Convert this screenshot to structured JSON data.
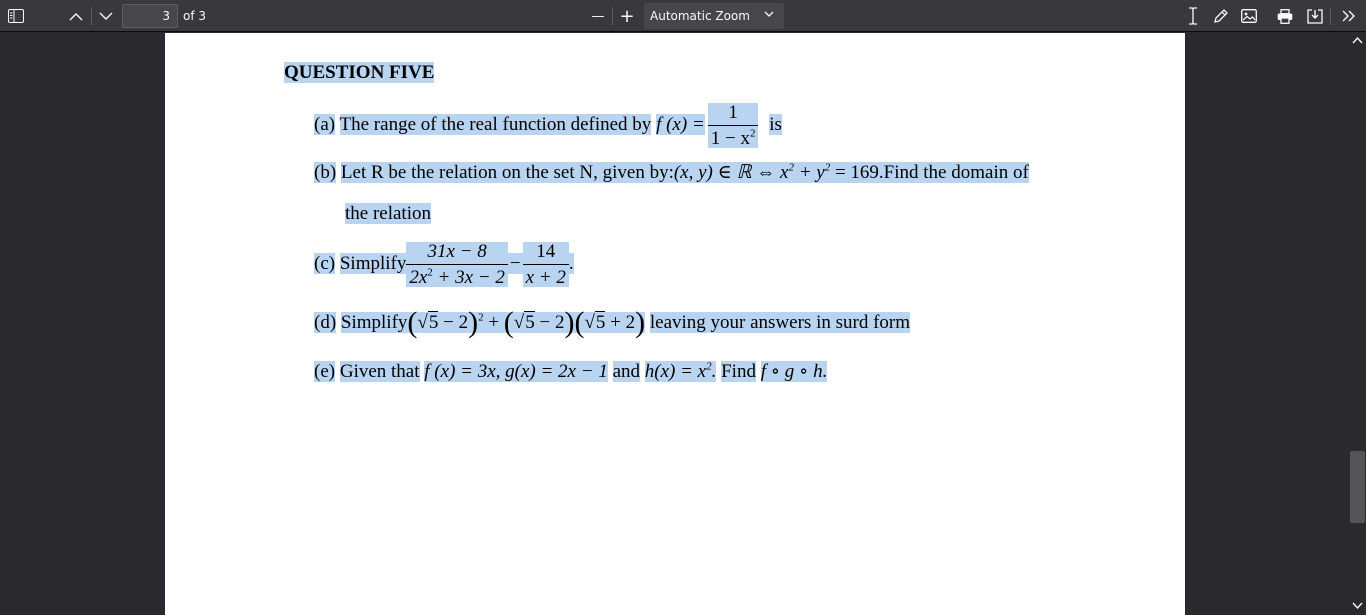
{
  "toolbar": {
    "page_number": "3",
    "page_count": "of 3",
    "zoom_label": "Automatic Zoom",
    "zoom_out_symbol": "—",
    "zoom_in_symbol": "+"
  },
  "icons": {
    "sidebar": "sidebar-toggle-icon",
    "prev": "chevron-up-icon",
    "next": "chevron-down-icon",
    "text": "text-cursor-icon",
    "draw": "pencil-icon",
    "image": "image-icon",
    "print": "printer-icon",
    "save": "download-icon",
    "tools": "double-chevron-right-icon"
  },
  "document": {
    "heading": "QUESTION FIVE",
    "q_a": {
      "label": "(a)",
      "text": "The range of the real function defined by",
      "func": "f (x) =",
      "num": "1",
      "den": "1 − x",
      "den_exp": "2",
      "tail": "is"
    },
    "q_b": {
      "label": "(b)",
      "text": "Let R be the relation on the set N, given by:",
      "math_lead": "(x, y) ∈ ℝ ⇔ x",
      "exp1": "2",
      "math_mid": " + y",
      "exp2": "2",
      "math_tail": " = 169.",
      "tail": "Find the domain of",
      "line2": "the relation"
    },
    "q_c": {
      "label": "(c)",
      "text": "Simplify",
      "frac1_num": "31x − 8",
      "frac1_den_a": "2x",
      "frac1_den_exp": "2",
      "frac1_den_b": " + 3x − 2",
      "op": "−",
      "frac2_num": "14",
      "frac2_den": "x + 2",
      "end": "."
    },
    "q_d": {
      "label": "(d)",
      "text": "Simplify",
      "paren_open": "(",
      "paren_close": ")",
      "radicand": "5",
      "term1_tail": " − 2",
      "exp": "2",
      "plus": " + ",
      "term2_tail": " − 2",
      "term3_tail": " + 2",
      "sqrt_symbol": "√",
      "tail": "leaving your answers in surd form"
    },
    "q_e": {
      "label": "(e)",
      "text": "Given that",
      "math": "f (x) = 3x,  g(x) = 2x − 1",
      "and": "and",
      "h_lead": "h(x) = x",
      "h_exp": "2",
      "h_tail": ".",
      "find": "Find",
      "compose": "f ∘ g ∘ h."
    }
  },
  "colors": {
    "toolbar_bg": "#38383d",
    "viewer_bg": "#2a2a2e",
    "page_bg": "#ffffff",
    "selection": "#b9d4f1"
  }
}
